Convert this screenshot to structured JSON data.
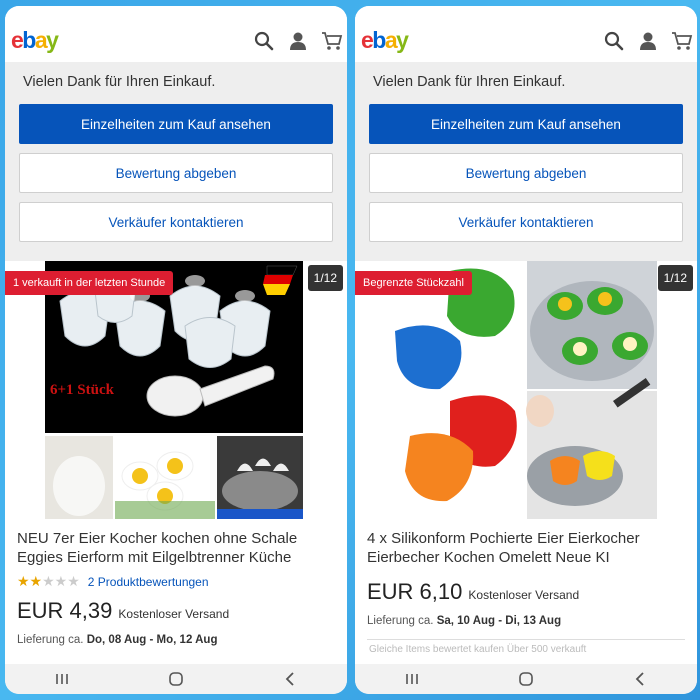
{
  "header": {
    "logo": {
      "e": "e",
      "b": "b",
      "a": "a",
      "y": "y"
    },
    "icons": [
      "search-icon",
      "user-icon",
      "cart-icon"
    ]
  },
  "colors": {
    "primary": "#0654ba",
    "badge": "#dd1e31",
    "star": "#e8a400"
  },
  "left": {
    "thanks": "Vielen Dank für Ihren Einkauf.",
    "btn_details": "Einzelheiten zum Kauf ansehen",
    "btn_review": "Bewertung abgeben",
    "btn_contact": "Verkäufer kontaktieren",
    "badge": "1 verkauft in der letzten Stunde",
    "counter": "1/12",
    "image_text": "6+1 Stück",
    "title": "NEU 7er Eier Kocher kochen ohne Schale Eggies Eierform mit Eilgelbtrenner Küche",
    "rating_stars": 2,
    "rating_link": "2 Produktbewertungen",
    "price": "EUR 4,39",
    "shipping": "Kostenloser Versand",
    "delivery_label": "Lieferung ca.",
    "delivery_dates": "Do, 08 Aug - Mo, 12 Aug"
  },
  "right": {
    "thanks": "Vielen Dank für Ihren Einkauf.",
    "btn_details": "Einzelheiten zum Kauf ansehen",
    "btn_review": "Bewertung abgeben",
    "btn_contact": "Verkäufer kontaktieren",
    "badge": "Begrenzte Stückzahl",
    "counter": "1/12",
    "title": "4 x Silikonform Pochierte Eier Eierkocher Eierbecher Kochen Omelett Neue KI",
    "price": "EUR 6,10",
    "shipping": "Kostenloser Versand",
    "delivery_label": "Lieferung ca.",
    "delivery_dates": "Sa, 10 Aug - Di, 13 Aug",
    "faded_text": "Gleiche Items bewertet kaufen Über 500 verkauft"
  }
}
